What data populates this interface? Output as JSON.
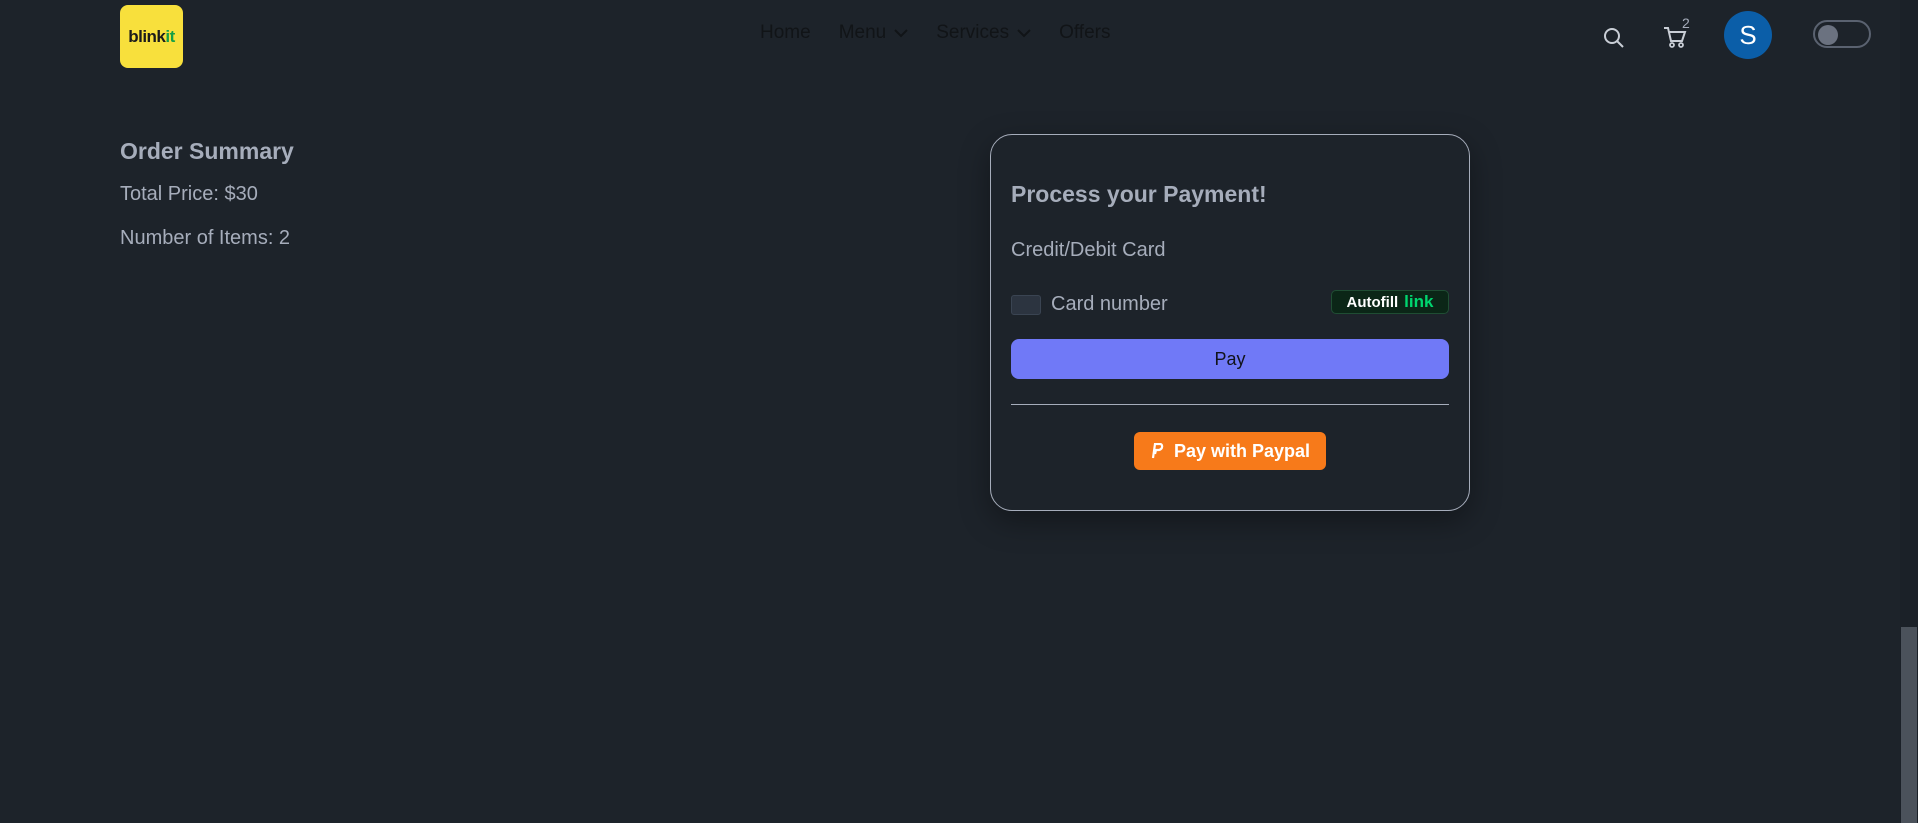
{
  "navbar": {
    "logo_text_part1": "blink",
    "logo_text_part2": "it",
    "menu": [
      {
        "label": "Home"
      },
      {
        "label": "Menu"
      },
      {
        "label": "Services"
      },
      {
        "label": "Offers"
      }
    ],
    "cart_count": "2",
    "avatar_initial": "S"
  },
  "summary": {
    "title": "Order Summary",
    "total_price": "Total Price: $30",
    "item_count": "Number of Items: 2"
  },
  "payment": {
    "title": "Process your Payment!",
    "card_section_label": "Credit/Debit Card",
    "card_placeholder": "Card number",
    "autofill_label": "Autofill",
    "autofill_brand": "link",
    "pay_button": "Pay",
    "paypal_button": "Pay with Paypal"
  },
  "colors": {
    "background": "#1d232a",
    "text": "#a6adbb",
    "logo_yellow": "#f8e03c",
    "avatar_blue": "#0b5ea8",
    "pay_button": "#7079f7",
    "paypal_button": "#f77a1a",
    "link_green": "#00d66f"
  },
  "icons": [
    "search-icon",
    "cart-icon",
    "chevron-down-icon",
    "card-icon",
    "paypal-icon"
  ]
}
